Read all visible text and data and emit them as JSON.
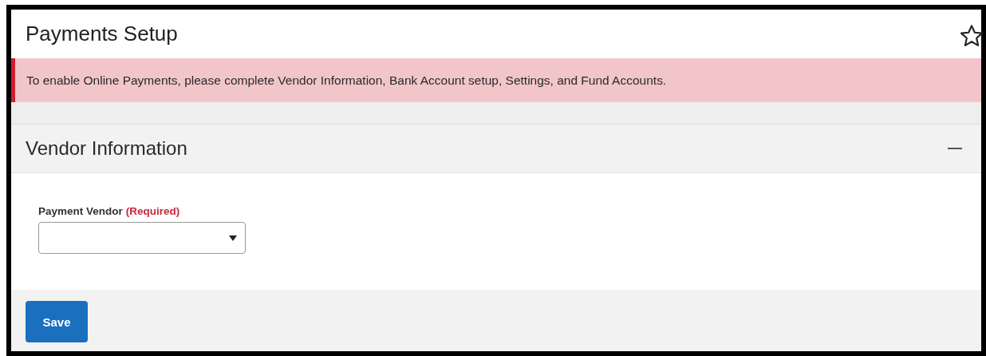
{
  "page": {
    "title": "Payments Setup"
  },
  "alert": {
    "message": "To enable Online Payments, please complete Vendor Information, Bank Account setup, Settings, and Fund Accounts."
  },
  "section": {
    "title": "Vendor Information",
    "expanded": true,
    "fields": [
      {
        "label": "Payment Vendor",
        "required_note": "(Required)",
        "kind": "dropdown"
      }
    ]
  },
  "buttons": [
    "Save"
  ]
}
